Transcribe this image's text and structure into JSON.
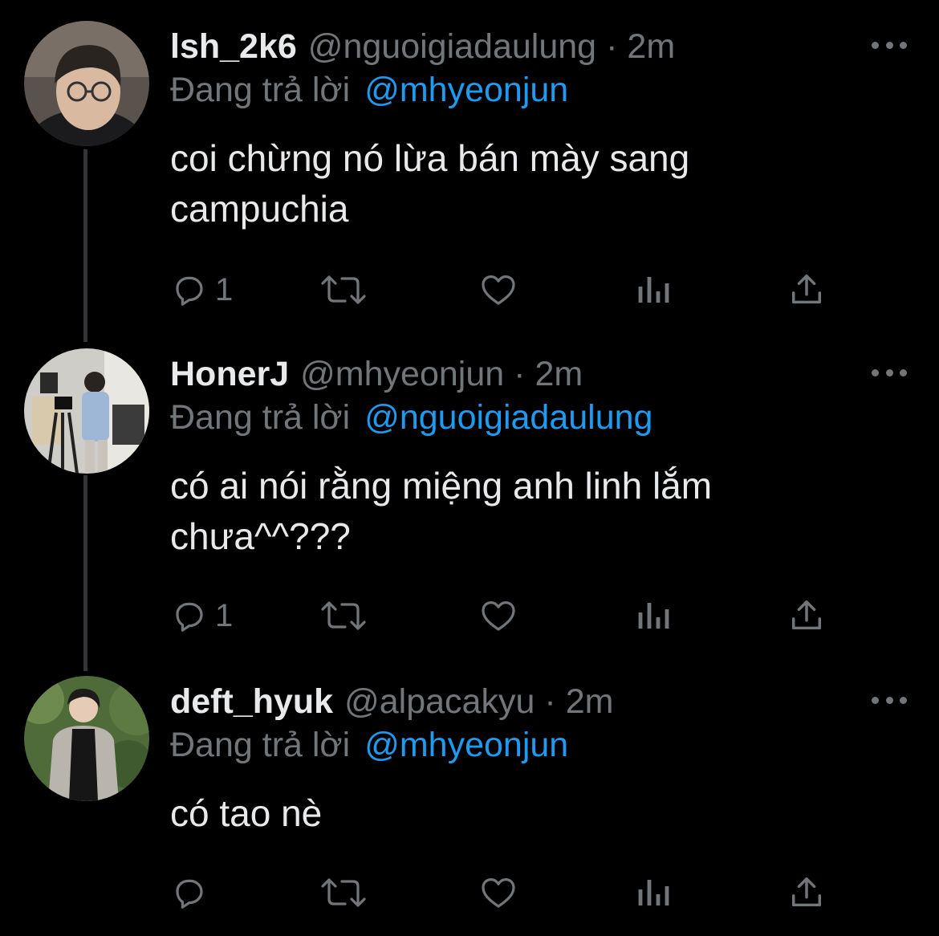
{
  "reply_prefix": "Đang trả lời",
  "tweets": [
    {
      "display_name": "lsh_2k6",
      "handle": "@nguoigiadaulung",
      "separator": "·",
      "time": "2m",
      "reply_to": "@mhyeonjun",
      "text_lines": [
        "coi chừng nó lừa bán mày sang",
        "campuchia"
      ],
      "reply_count": "1"
    },
    {
      "display_name": "HonerJ",
      "handle": "@mhyeonjun",
      "separator": "·",
      "time": "2m",
      "reply_to": "@nguoigiadaulung",
      "text_lines": [
        "có ai nói rằng miệng anh linh lắm",
        "chưa^^???"
      ],
      "reply_count": "1"
    },
    {
      "display_name": "deft_hyuk",
      "handle": "@alpacakyu",
      "separator": "·",
      "time": "2m",
      "reply_to": "@mhyeonjun",
      "text_lines": [
        "có tao nè"
      ],
      "reply_count": ""
    }
  ],
  "icons": {
    "reply": "reply-icon",
    "retweet": "retweet-icon",
    "like": "heart-icon",
    "views": "views-icon",
    "share": "share-icon",
    "more": "more-icon"
  },
  "colors": {
    "background": "#000000",
    "text": "#e7e9ea",
    "secondary": "#71767b",
    "link": "#1d9bf0",
    "thread_line": "#333639"
  }
}
